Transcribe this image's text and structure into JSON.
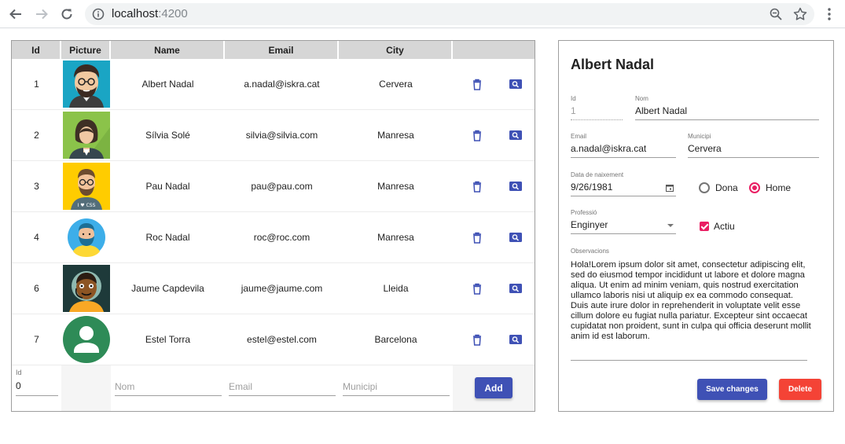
{
  "browser": {
    "url_host": "localhost",
    "url_port": ":4200"
  },
  "table": {
    "headers": [
      "Id",
      "Picture",
      "Name",
      "Email",
      "City",
      ""
    ],
    "rows": [
      {
        "id": "1",
        "name": "Albert Nadal",
        "email": "a.nadal@iskra.cat",
        "city": "Cervera",
        "avatar": "man-beard-glasses-avatar"
      },
      {
        "id": "2",
        "name": "Sílvia Solé",
        "email": "silvia@silvia.com",
        "city": "Manresa",
        "avatar": "woman-avatar"
      },
      {
        "id": "3",
        "name": "Pau Nadal",
        "email": "pau@pau.com",
        "city": "Manresa",
        "avatar": "man-css-shirt-avatar"
      },
      {
        "id": "4",
        "name": "Roc Nadal",
        "email": "roc@roc.com",
        "city": "Manresa",
        "avatar": "bearded-man-avatar"
      },
      {
        "id": "6",
        "name": "Jaume Capdevila",
        "email": "jaume@jaume.com",
        "city": "Lleida",
        "avatar": "man-headset-avatar"
      },
      {
        "id": "7",
        "name": "Estel Torra",
        "email": "estel@estel.com",
        "city": "Barcelona",
        "avatar": "default-user-avatar"
      }
    ],
    "add_row": {
      "id_label": "Id",
      "id_value": "0",
      "name_placeholder": "Nom",
      "email_placeholder": "Email",
      "city_placeholder": "Municipi",
      "add_label": "Add"
    }
  },
  "detail": {
    "title": "Albert Nadal",
    "id_label": "Id",
    "id_value": "1",
    "nom_label": "Nom",
    "nom_value": "Albert Nadal",
    "email_label": "Email",
    "email_value": "a.nadal@iskra.cat",
    "municipi_label": "Municipi",
    "municipi_value": "Cervera",
    "birth_label": "Data de naixement",
    "birth_value": "9/26/1981",
    "gender_female": "Dona",
    "gender_male": "Home",
    "gender_selected": "Home",
    "profession_label": "Professió",
    "profession_value": "Enginyer",
    "active_label": "Actiu",
    "active_checked": true,
    "obs_label": "Observacions",
    "obs_value": "Hola!Lorem ipsum dolor sit amet, consectetur adipiscing elit, sed do eiusmod tempor incididunt ut labore et dolore magna aliqua. Ut enim ad minim veniam, quis nostrud exercitation ullamco laboris nisi ut aliquip ex ea commodo consequat. Duis aute irure dolor in reprehenderit in voluptate velit esse cillum dolore eu fugiat nulla pariatur. Excepteur sint occaecat cupidatat non proident, sunt in culpa qui officia deserunt mollit anim id est laborum.",
    "save_label": "Save changes",
    "delete_label": "Delete"
  },
  "colors": {
    "primary": "#3f51b5",
    "accent": "#e91e63",
    "warn": "#f44336"
  }
}
